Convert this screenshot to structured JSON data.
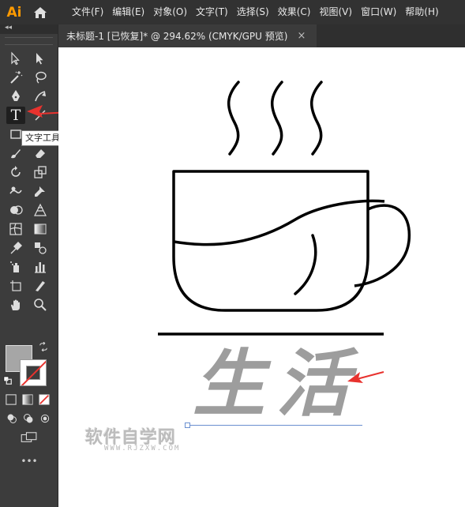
{
  "app": {
    "logo_text": "Ai",
    "accent": "#ff9a00"
  },
  "menu": [
    {
      "label": "文件(F)"
    },
    {
      "label": "编辑(E)"
    },
    {
      "label": "对象(O)"
    },
    {
      "label": "文字(T)"
    },
    {
      "label": "选择(S)"
    },
    {
      "label": "效果(C)"
    },
    {
      "label": "视图(V)"
    },
    {
      "label": "窗口(W)"
    },
    {
      "label": "帮助(H)"
    }
  ],
  "document_tab": {
    "title": "未标题-1 [已恢复]* @ 294.62% (CMYK/GPU 预览)",
    "close_label": "×"
  },
  "tools": {
    "collapse_label": "◂◂",
    "type_tool_glyph": "T",
    "tooltip": "文字工具 (T)",
    "more_label": "•••",
    "fill_color": "#a6a6a6",
    "stroke_color": "none"
  },
  "canvas": {
    "artwork_text": "生活",
    "text_fill_color": "#9d9d9d",
    "watermark_title": "软件自学网",
    "watermark_url": "WWW.RJZXW.COM"
  },
  "annotation_color": "#e8322e"
}
